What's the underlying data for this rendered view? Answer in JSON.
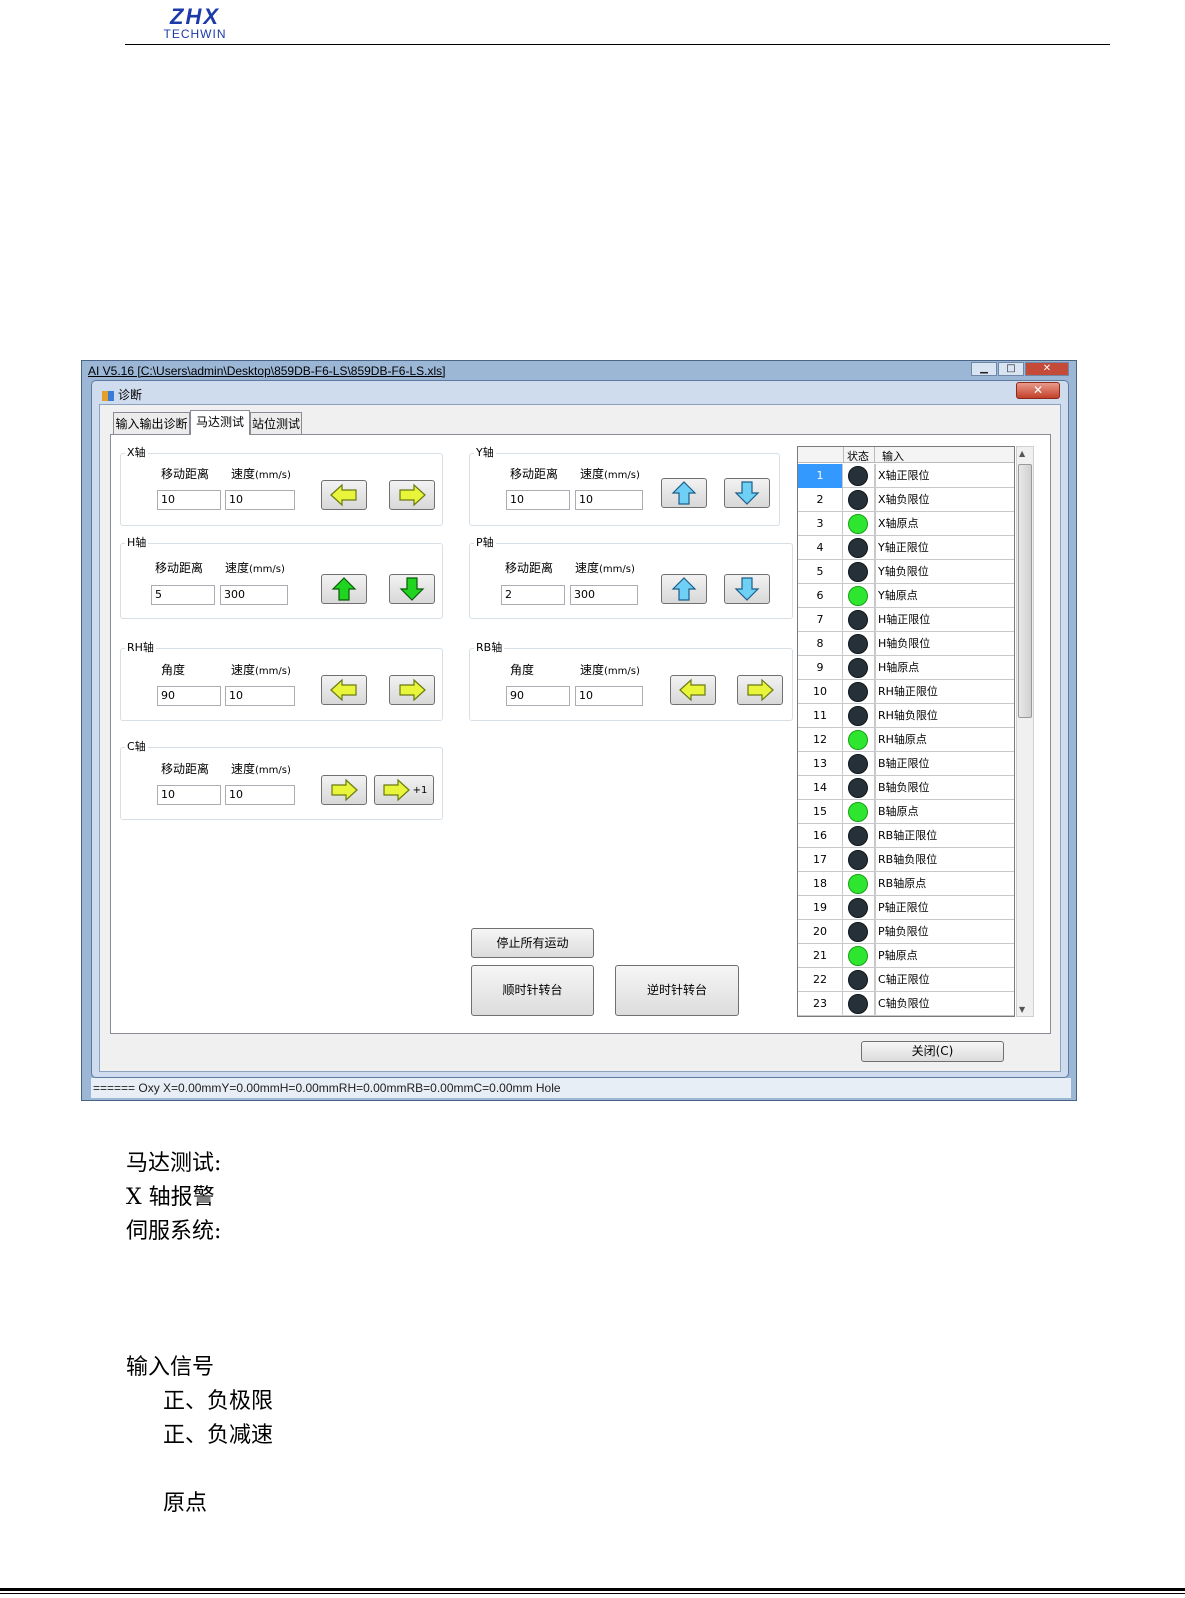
{
  "header": {
    "logo_main": "ZHX",
    "logo_sub": "TECHWIN"
  },
  "window": {
    "title": "AI V5.16 [C:\\Users\\admin\\Desktop\\859DB-F6-LS\\859DB-F6-LS.xls]",
    "status_bar": "====== Oxy  X=0.00mmY=0.00mmH=0.00mmRH=0.00mmRB=0.00mmC=0.00mm  Hole"
  },
  "dialog": {
    "title": "诊断",
    "tabs": [
      "输入输出诊断",
      "马达测试",
      "站位测试"
    ],
    "active_tab": "马达测试",
    "close_button": "关闭(C)",
    "stop_button": "停止所有运动",
    "cw_button": "顺时针转台",
    "ccw_button": "逆时针转台"
  },
  "axes": {
    "x": {
      "title": "X轴",
      "dist_label": "移动距离",
      "speed_label": "速度",
      "unit": "(mm/s)",
      "dist": "10",
      "speed": "10"
    },
    "y": {
      "title": "Y轴",
      "dist_label": "移动距离",
      "speed_label": "速度",
      "unit": "(mm/s)",
      "dist": "10",
      "speed": "10"
    },
    "h": {
      "title": "H轴",
      "dist_label": "移动距离",
      "speed_label": "速度",
      "unit": "(mm/s)",
      "dist": "5",
      "speed": "300"
    },
    "p": {
      "title": "P轴",
      "dist_label": "移动距离",
      "speed_label": "速度",
      "unit": "(mm/s)",
      "dist": "2",
      "speed": "300"
    },
    "rh": {
      "title": "RH轴",
      "dist_label": "角度",
      "speed_label": "速度",
      "unit": "(mm/s)",
      "dist": "90",
      "speed": "10"
    },
    "rb": {
      "title": "RB轴",
      "dist_label": "角度",
      "speed_label": "速度",
      "unit": "(mm/s)",
      "dist": "90",
      "speed": "10"
    },
    "c": {
      "title": "C轴",
      "dist_label": "移动距离",
      "speed_label": "速度",
      "unit": "(mm/s)",
      "dist": "10",
      "speed": "10",
      "plus_one": "+1"
    }
  },
  "io_grid": {
    "headers": [
      "状态",
      "输入"
    ],
    "rows": [
      {
        "n": "1",
        "on": false,
        "name": "X轴正限位"
      },
      {
        "n": "2",
        "on": false,
        "name": "X轴负限位"
      },
      {
        "n": "3",
        "on": true,
        "name": "X轴原点"
      },
      {
        "n": "4",
        "on": false,
        "name": "Y轴正限位"
      },
      {
        "n": "5",
        "on": false,
        "name": "Y轴负限位"
      },
      {
        "n": "6",
        "on": true,
        "name": "Y轴原点"
      },
      {
        "n": "7",
        "on": false,
        "name": "H轴正限位"
      },
      {
        "n": "8",
        "on": false,
        "name": "H轴负限位"
      },
      {
        "n": "9",
        "on": false,
        "name": "H轴原点"
      },
      {
        "n": "10",
        "on": false,
        "name": "RH轴正限位"
      },
      {
        "n": "11",
        "on": false,
        "name": "RH轴负限位"
      },
      {
        "n": "12",
        "on": true,
        "name": "RH轴原点"
      },
      {
        "n": "13",
        "on": false,
        "name": "B轴正限位"
      },
      {
        "n": "14",
        "on": false,
        "name": "B轴负限位"
      },
      {
        "n": "15",
        "on": true,
        "name": "B轴原点"
      },
      {
        "n": "16",
        "on": false,
        "name": "RB轴正限位"
      },
      {
        "n": "17",
        "on": false,
        "name": "RB轴负限位"
      },
      {
        "n": "18",
        "on": true,
        "name": "RB轴原点"
      },
      {
        "n": "19",
        "on": false,
        "name": "P轴正限位"
      },
      {
        "n": "20",
        "on": false,
        "name": "P轴负限位"
      },
      {
        "n": "21",
        "on": true,
        "name": "P轴原点"
      },
      {
        "n": "22",
        "on": false,
        "name": "C轴正限位"
      },
      {
        "n": "23",
        "on": false,
        "name": "C轴负限位"
      }
    ],
    "selected_row": "1",
    "colors": {
      "on": "#2ee62e",
      "off": "#253038"
    }
  },
  "document": {
    "line1": "马达测试:",
    "line2": "X 轴报警",
    "line3": "伺服系统:",
    "line4": "输入信号",
    "line5": "正、负极限",
    "line6": "正、负减速",
    "line7": "原点"
  }
}
